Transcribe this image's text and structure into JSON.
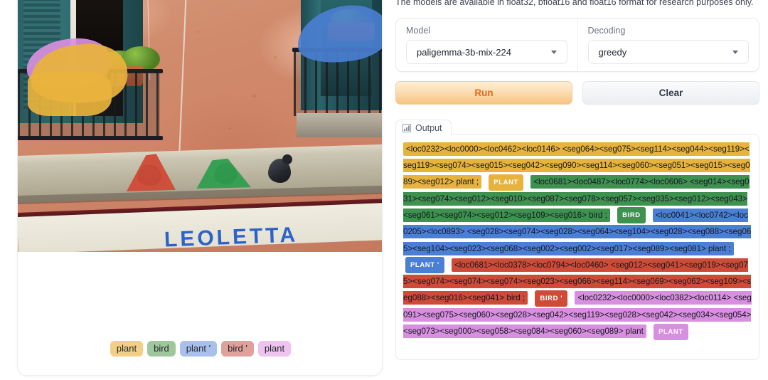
{
  "notice": "The models are available in float32, bfloat16 and float16 format for research purposes only.",
  "controls": {
    "model": {
      "label": "Model",
      "value": "paligemma-3b-mix-224",
      "caret_icon": "chevron-down-icon"
    },
    "decoding": {
      "label": "Decoding",
      "value": "greedy",
      "caret_icon": "chevron-down-icon"
    }
  },
  "buttons": {
    "run": "Run",
    "clear": "Clear"
  },
  "output_tab": {
    "label": "Output",
    "icon": "image-chart-icon"
  },
  "colors": {
    "plant": "#e8b33c",
    "bird": "#3f9150",
    "plant_prime": "#4a7fd4",
    "bird_prime": "#cf4a37",
    "plant_2": "#d98fe0",
    "run_accent": "#e2671e",
    "legend_plant": "#f2cf86",
    "legend_bird": "#9ec79c",
    "legend_plant_prime": "#a9c0ec",
    "legend_bird_prime": "#dfa19a",
    "legend_plant_2": "#eec3ef"
  },
  "legend": [
    {
      "label": "plant",
      "color": "#f2cf86"
    },
    {
      "label": "bird",
      "color": "#9ec79c"
    },
    {
      "label": "plant '",
      "color": "#a9c0ec"
    },
    {
      "label": "bird '",
      "color": "#dfa19a"
    },
    {
      "label": "plant",
      "color": "#eec3ef"
    }
  ],
  "image": {
    "sign_text": "LEOLETTA",
    "description": "balcony-with-plants-and-pigeons-segmentation"
  },
  "output_segments": [
    {
      "color": "#e8b33c",
      "text": "<loc0232><loc0000><loc0462><loc0146> <seg064><seg075><seg114><seg044><seg119><seg119><seg074><seg015><seg042><seg090><seg114><seg060><seg051><seg015><seg089><seg012> plant ;",
      "chip": "PLANT"
    },
    {
      "color": "#3f9150",
      "text": "<loc0681><loc0487><loc0774><loc0606> <seg014><seg031><seg074><seg012><seg010><seg087><seg078><seg057><seg035><seg012><seg043><seg061><seg074><seg012><seg109><seg016> bird ;",
      "chip": "BIRD"
    },
    {
      "color": "#4a7fd4",
      "text": "<loc0041><loc0742><loc0205><loc0893> <seg028><seg074><seg028><seg064><seg104><seg028><seg088><seg065><seg104><seg023><seg068><seg002><seg002><seg017><seg089><seg081> plant ;",
      "chip": "PLANT '"
    },
    {
      "color": "#cf4a37",
      "text": "<loc0681><loc0378><loc0794><loc0460> <seg012><seg041><seg019><seg075><seg074><seg074><seg074><seg023><seg066><seg114><seg069><seg062><seg109><seg088><seg016><seg041> bird ;",
      "chip": "BIRD '"
    },
    {
      "color": "#d98fe0",
      "text": "<loc0232><loc0000><loc0382><loc0114> <seg091><seg075><seg060><seg028><seg042><seg119><seg028><seg042><seg034><seg054><seg073><seg000><seg058><seg084><seg060><seg089> plant",
      "chip": "PLANT"
    }
  ]
}
